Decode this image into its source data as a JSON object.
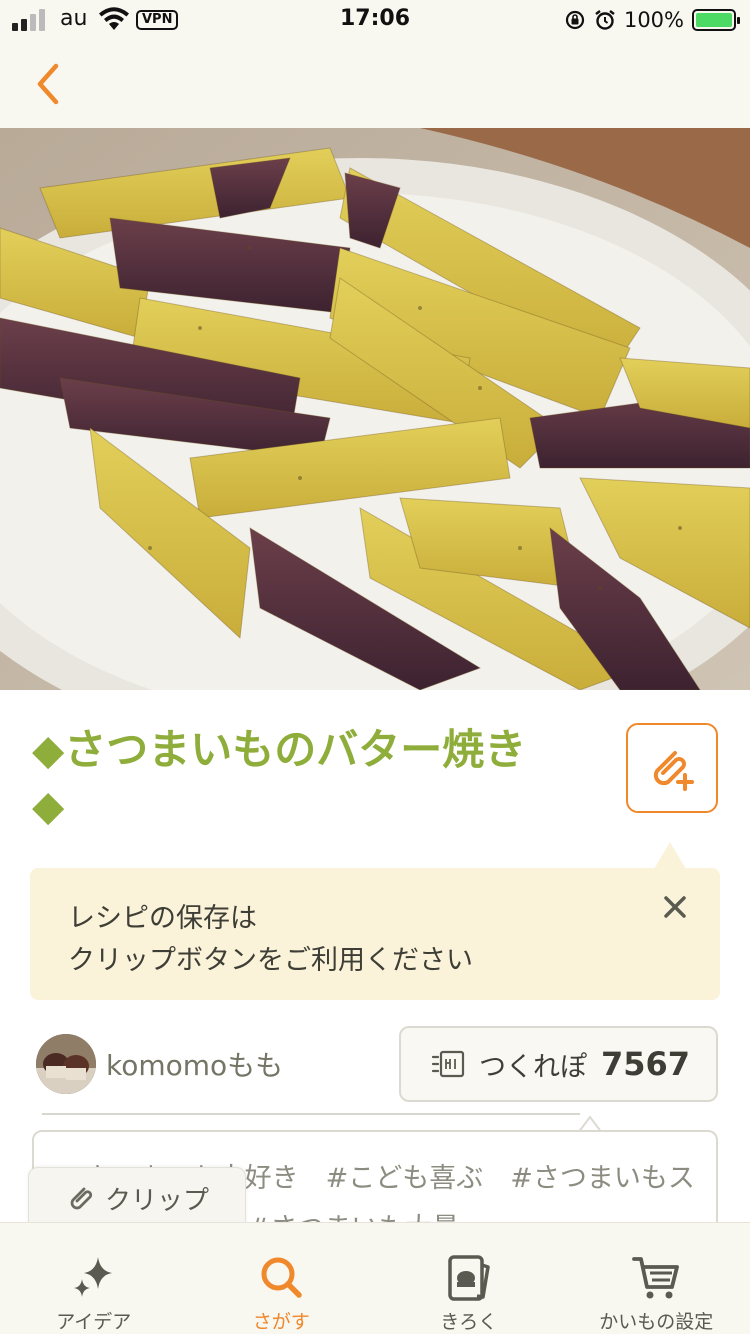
{
  "status_bar": {
    "carrier": "au",
    "vpn": "VPN",
    "time": "17:06",
    "battery": "100%",
    "battery_level": 1.0
  },
  "nav": {
    "back_icon": "chevron-left-icon"
  },
  "recipe": {
    "title_line1": "◆さつまいものバター焼き",
    "title_line2": "◆",
    "clip_add_icon": "clip-plus-icon"
  },
  "tooltip": {
    "text": "レシピの保存は\nクリップボタンをご利用ください",
    "close_icon": "close-icon"
  },
  "author": {
    "name": "komomoもも"
  },
  "tsukurepo": {
    "label": "つくれぽ",
    "count": "7567"
  },
  "tags": {
    "line1": "#さつまいも大好き　#こども喜ぶ　#さつまいもス",
    "line2": "もがパクパク　#さつまいも大量…"
  },
  "clip_button": {
    "label": "クリップ"
  },
  "tabbar": {
    "items": [
      {
        "label": "アイデア",
        "icon": "sparkle-icon"
      },
      {
        "label": "さがす",
        "icon": "search-icon"
      },
      {
        "label": "きろく",
        "icon": "record-icon"
      },
      {
        "label": "かいもの設定",
        "icon": "cart-icon"
      }
    ]
  },
  "colors": {
    "accent": "#f0882c",
    "title": "#8ead3a",
    "tooltip_bg": "#faf3d9",
    "bar_bg": "#f8f7f0"
  }
}
